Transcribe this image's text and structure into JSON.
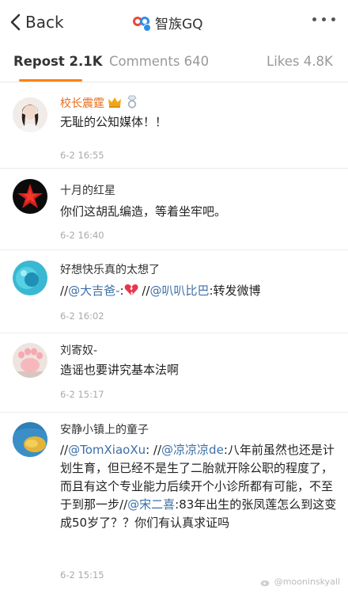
{
  "header": {
    "back_label": "Back",
    "title": "智族GQ",
    "logo_colors": {
      "red": "#e84a3c",
      "blue": "#2d8ee8"
    }
  },
  "tabs": [
    {
      "label": "Repost 2.1K",
      "active": true
    },
    {
      "label": "Comments 640",
      "active": false
    },
    {
      "label": "Likes 4.8K",
      "active": false
    }
  ],
  "accent_color": "#ff8200",
  "reposts": [
    {
      "name": "校长震霆",
      "badges": [
        "crown-icon",
        "diamond-ring-icon"
      ],
      "text": "无耻的公知媒体！！",
      "time": "6-2 16:55"
    },
    {
      "name": "十月的红星",
      "text": "你们这胡乱编造，等着坐牢吧。",
      "time": "6-2 16:40"
    },
    {
      "name": "好想快乐真的太想了",
      "parts": [
        "//",
        "@大吉爸-",
        ":",
        "//",
        "@叭叭比巴",
        ":转发微博"
      ],
      "emoji": "broken-heart-icon",
      "time": "6-2 16:02"
    },
    {
      "name": "刘寄奴-",
      "text": "造谣也要讲究基本法啊",
      "time": "6-2 15:17"
    },
    {
      "name": "安静小镇上的童子",
      "parts": [
        "//",
        "@TomXiaoXu",
        ": //",
        "@凉凉凉de",
        ":八年前虽然也还是计划生育，但已经不是生了二胎就开除公职的程度了，而且有这个专业能力后续开个小诊所都有可能，不至于到那一步",
        "//",
        "@宋二喜",
        ":83年出生的张凤莲怎么到这变成50岁了？？你们有认真求证吗"
      ],
      "time": "6-2 15:15"
    }
  ],
  "watermark": "@mooninskyall"
}
